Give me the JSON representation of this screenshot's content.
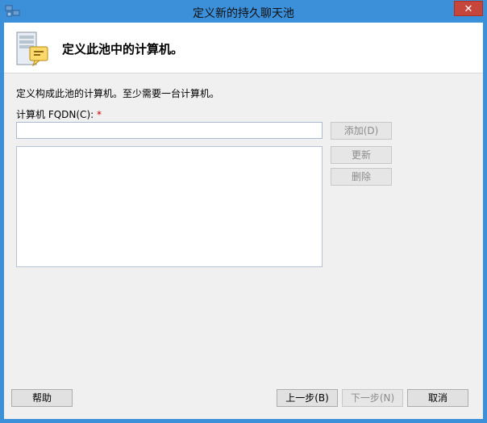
{
  "window": {
    "title": "定义新的持久聊天池",
    "close_label": "✕"
  },
  "header": {
    "title": "定义此池中的计算机。"
  },
  "body": {
    "description": "定义构成此池的计算机。至少需要一台计算机。",
    "fqdn_label": "计算机 FQDN(C):",
    "required_marker": "*",
    "fqdn_value": ""
  },
  "buttons": {
    "add": "添加(D)",
    "update": "更新",
    "delete": "删除",
    "help": "帮助",
    "back": "上一步(B)",
    "next": "下一步(N)",
    "cancel": "取消"
  },
  "computers": []
}
